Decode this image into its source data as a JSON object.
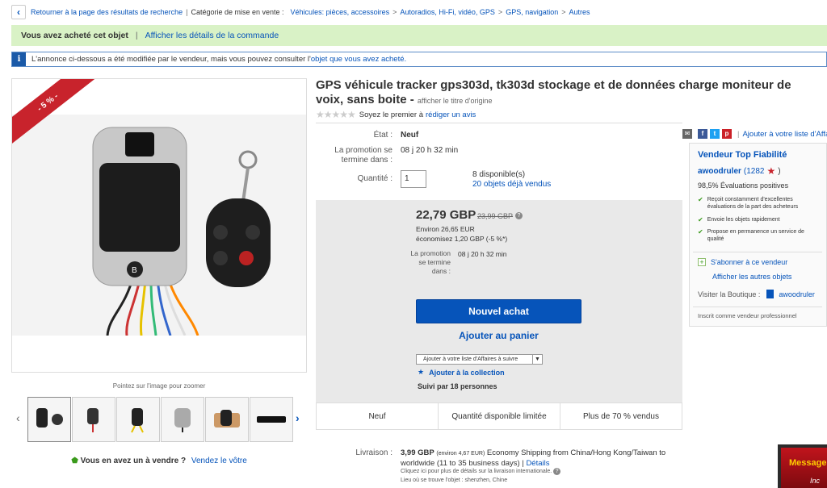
{
  "breadcrumb": {
    "back_label": "Retourner à la page des résultats de recherche",
    "category_label": "Catégorie de mise en vente :",
    "path": [
      "Véhicules: pièces, accessoires",
      "Autoradios, Hi-Fi, vidéo, GPS",
      "GPS, navigation",
      "Autres"
    ]
  },
  "purchase_bar": {
    "text": "Vous avez acheté cet objet",
    "link": "Afficher les détails de la commande"
  },
  "info_bar": {
    "text": "L'annonce ci-dessous a été modifiée par le vendeur, mais vous pouvez consulter l'",
    "link": "objet que vous avez acheté."
  },
  "image": {
    "discount_ribbon": "- 5 % -",
    "zoom_hint": "Pointez sur l'image pour zoomer",
    "thumbnail_count": 6
  },
  "sell_prompt": {
    "text": "Vous en avez un à vendre ?",
    "link": "Vendez le vôtre"
  },
  "listing": {
    "title": "GPS véhicule tracker gps303d, tk303d stockage et de données charge moniteur de voix, sans boite -",
    "title_orig_link": "afficher le titre d'origine",
    "review_prompt": "Soyez le premier à",
    "review_link": "rédiger un avis",
    "state_label": "État :",
    "state_value": "Neuf",
    "promo_label": "La promotion se termine dans :",
    "promo_value": "08 j 20 h 32 min",
    "qty_label": "Quantité :",
    "qty_value": "1",
    "available": "8 disponible(s)",
    "sold_link": "20 objets déjà vendus"
  },
  "buy_box": {
    "price": "22,79 GBP",
    "old_price": "23,99 GBP",
    "approx": "Environ 26,65 EUR",
    "savings": "économisez 1,20 GBP (-5 %*)",
    "promo_label": "La promotion se termine dans :",
    "promo_value": "08 j 20 h 32 min",
    "buy_now": "Nouvel achat",
    "add_cart": "Ajouter au panier",
    "watch_select": "Ajouter à votre liste d'Affaires à suivre",
    "collection": "Ajouter à la collection",
    "followers": "Suivi par 18 personnes"
  },
  "highlights": [
    "Neuf",
    "Quantité disponible limitée",
    "Plus de 70 % vendus"
  ],
  "shipping": {
    "label": "Livraison :",
    "price": "3,99 GBP",
    "approx": "(environ 4,67 EUR)",
    "method": "Economy Shipping from China/Hong Kong/Taiwan to worldwide (11 to 35 business days)",
    "details_link": "Détails",
    "note": "Cliquez ici pour plus de détails sur la livraison internationale.",
    "location": "Lieu où se trouve l'objet : shenzhen, Chine"
  },
  "share": {
    "watch_link": "Ajouter à votre liste d'Affaires"
  },
  "seller": {
    "badge": "Vendeur Top Fiabilité",
    "name": "awoodruler",
    "score": "(1282",
    "score_close": ")",
    "positive": "98,5% Évaluations positives",
    "perks": [
      "Reçoit constamment d'excellentes évaluations de la part des acheteurs",
      "Envoie les objets rapidement",
      "Propose en permanence un service de qualité"
    ],
    "follow": "S'abonner à ce vendeur",
    "other_items": "Afficher les autres objets",
    "shop_label": "Visiter la Boutique :",
    "shop_name": "awoodruler",
    "registered": "Inscrit comme vendeur professionnel"
  },
  "chat_widget": {
    "title": "Message",
    "subtitle": "Inc"
  },
  "colors": {
    "link": "#0654ba",
    "success_bar": "#d9f2c6",
    "ribbon": "#c8232c",
    "buy_button": "#0654ba"
  }
}
